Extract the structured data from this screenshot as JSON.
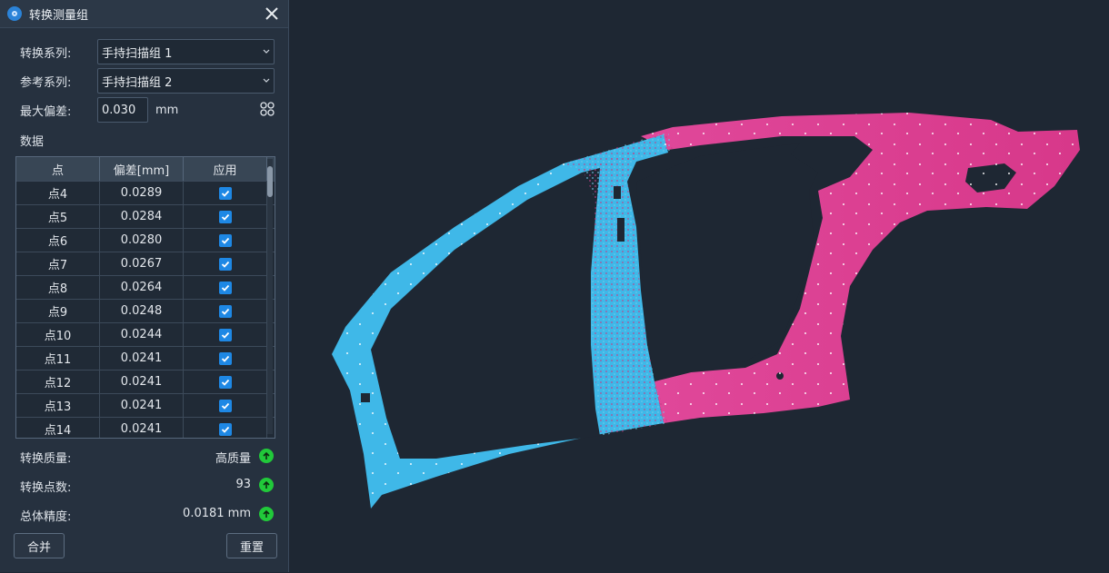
{
  "dialog": {
    "title": "转换测量组",
    "transform_series": {
      "label": "转换系列:",
      "value": "手持扫描组 1"
    },
    "reference_series": {
      "label": "参考系列:",
      "value": "手持扫描组 2"
    },
    "max_deviation": {
      "label": "最大偏差:",
      "value": "0.030",
      "unit": "mm"
    },
    "data_section_label": "数据",
    "table": {
      "headers": [
        "点",
        "偏差[mm]",
        "应用"
      ],
      "rows": [
        {
          "point": "点4",
          "deviation": "0.0289",
          "applied": true
        },
        {
          "point": "点5",
          "deviation": "0.0284",
          "applied": true
        },
        {
          "point": "点6",
          "deviation": "0.0280",
          "applied": true
        },
        {
          "point": "点7",
          "deviation": "0.0267",
          "applied": true
        },
        {
          "point": "点8",
          "deviation": "0.0264",
          "applied": true
        },
        {
          "point": "点9",
          "deviation": "0.0248",
          "applied": true
        },
        {
          "point": "点10",
          "deviation": "0.0244",
          "applied": true
        },
        {
          "point": "点11",
          "deviation": "0.0241",
          "applied": true
        },
        {
          "point": "点12",
          "deviation": "0.0241",
          "applied": true
        },
        {
          "point": "点13",
          "deviation": "0.0241",
          "applied": true
        },
        {
          "point": "点14",
          "deviation": "0.0241",
          "applied": true
        }
      ]
    },
    "stats": {
      "quality": {
        "label": "转换质量:",
        "value": "高质量"
      },
      "points": {
        "label": "转换点数:",
        "value": "93"
      },
      "accuracy": {
        "label": "总体精度:",
        "value": "0.0181 mm"
      }
    },
    "merge_button": "合并",
    "reset_button": "重置"
  },
  "colors": {
    "background": "#1e2733",
    "part_cyan": "#3fb8e8",
    "part_magenta": "#dd3f8f",
    "checkbox": "#1e88e5",
    "ok_status": "#21c93a"
  },
  "icons": [
    "app-icon",
    "close-icon",
    "chevron-down-icon",
    "grid-icon",
    "check-icon",
    "ok-arrow-icon"
  ]
}
